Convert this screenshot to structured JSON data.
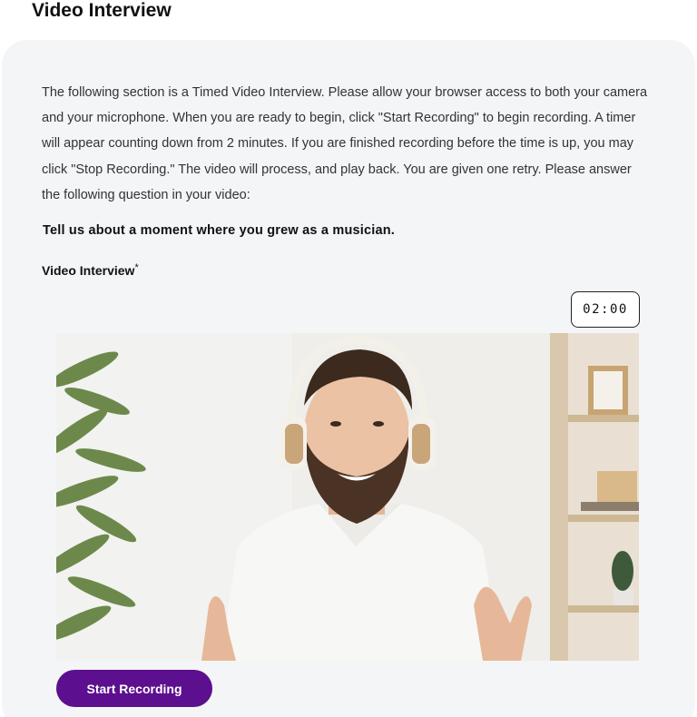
{
  "page": {
    "title": "Video Interview"
  },
  "section": {
    "instructions": "The following section is a Timed Video Interview. Please allow your browser access to both your camera and your microphone. When you are ready to begin, click \"Start Recording\" to begin recording. A timer will appear counting down from 2 minutes. If you are finished recording before the time is up, you may click \"Stop Recording.\" The video will process, and play back. You are given one retry. Please answer the following question in your video:",
    "question": "Tell us about a moment where you grew as a musician.",
    "field_label": "Video Interview",
    "required_marker": "*"
  },
  "recorder": {
    "timer": "02:00",
    "preview_subject": "man-with-headphones",
    "start_button_label": "Start Recording",
    "button_color": "#5c0f8f"
  }
}
